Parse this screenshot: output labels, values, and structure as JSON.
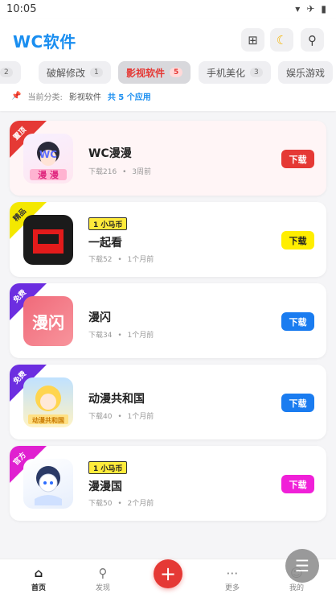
{
  "status_bar": {
    "time": "10:05",
    "icons": [
      "wifi-icon",
      "airplane-icon",
      "battery-icon"
    ]
  },
  "header": {
    "title": "WC软件",
    "buttons": [
      "grid-icon",
      "moon-icon",
      "search-icon"
    ]
  },
  "tabs": [
    {
      "label": "",
      "count": "2"
    },
    {
      "label": "破解修改",
      "count": "1"
    },
    {
      "label": "影视软件",
      "count": "5",
      "active": true
    },
    {
      "label": "手机美化",
      "count": "3"
    },
    {
      "label": "娱乐游戏",
      "count": ""
    }
  ],
  "crumb": {
    "prefix": "当前分类:",
    "category": "影视软件",
    "count": "共 5 个应用"
  },
  "apps": [
    {
      "ribbon": "置顶",
      "ribbon_color": "#e53935",
      "name": "WC漫漫",
      "downloads": "下载216",
      "time": "3周前",
      "coin": "",
      "button": "下载",
      "button_color": "#e53935",
      "button_text_color": "#ffffff",
      "icon_label": "WC 漫漫"
    },
    {
      "ribbon": "精品",
      "ribbon_color": "#f4e800",
      "name": "一起看",
      "downloads": "下载52",
      "time": "1个月前",
      "coin": "1 小马币",
      "button": "下载",
      "button_color": "#ffee00",
      "button_text_color": "#222222",
      "icon_label": ""
    },
    {
      "ribbon": "免费",
      "ribbon_color": "#6c2ee0",
      "name": "漫闪",
      "downloads": "下载34",
      "time": "1个月前",
      "coin": "",
      "button": "下载",
      "button_color": "#1a7cf0",
      "button_text_color": "#ffffff",
      "icon_label": "漫闪"
    },
    {
      "ribbon": "免费",
      "ribbon_color": "#6c2ee0",
      "name": "动漫共和国",
      "downloads": "下载40",
      "time": "1个月前",
      "coin": "",
      "button": "下载",
      "button_color": "#1a7cf0",
      "button_text_color": "#ffffff",
      "icon_label": "动漫共和国"
    },
    {
      "ribbon": "官方",
      "ribbon_color": "#e020d0",
      "name": "漫漫国",
      "downloads": "下载50",
      "time": "2个月前",
      "coin": "1 小马币",
      "button": "下载",
      "button_color": "#f020d8",
      "button_text_color": "#ffffff",
      "icon_label": ""
    }
  ],
  "bottom_nav": [
    {
      "label": "首页",
      "icon": "home-icon",
      "active": true
    },
    {
      "label": "发现",
      "icon": "search-icon"
    },
    {
      "label": "",
      "icon": "add-icon"
    },
    {
      "label": "更多",
      "icon": "more-icon"
    },
    {
      "label": "我的",
      "icon": "user-icon"
    }
  ],
  "dot": "•"
}
